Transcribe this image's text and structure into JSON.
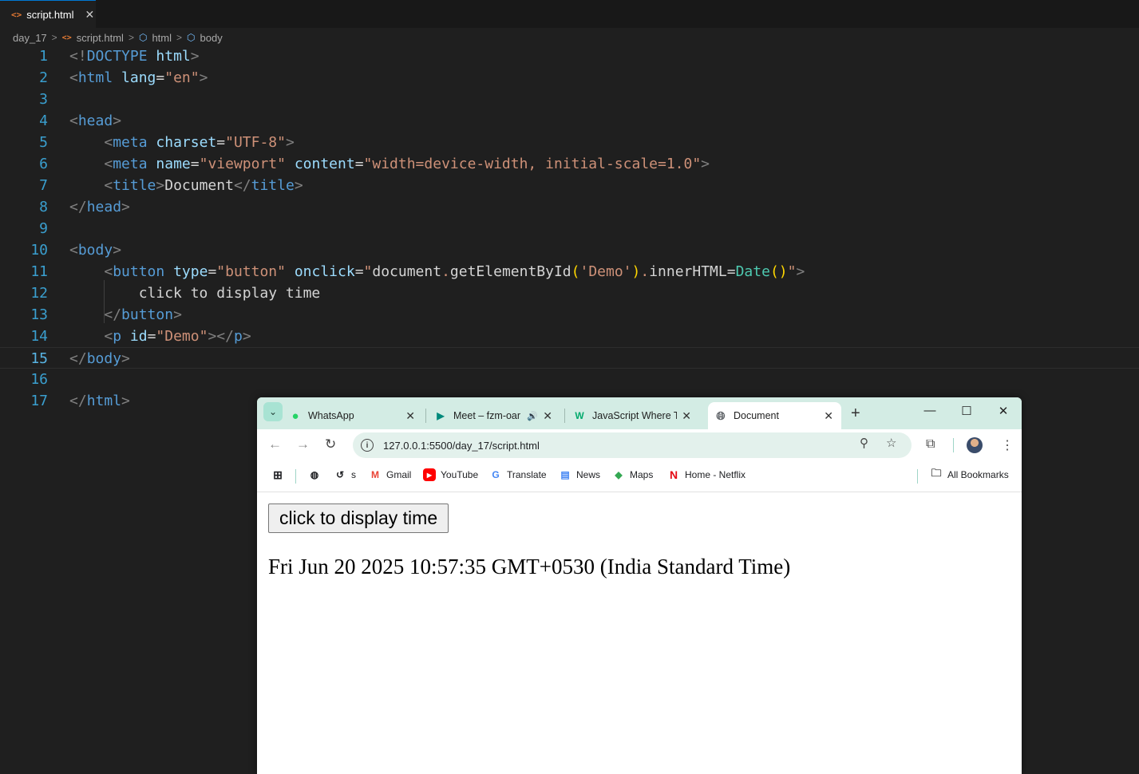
{
  "editor": {
    "tab": {
      "label": "script.html",
      "close": "✕"
    },
    "breadcrumb": [
      "day_17",
      "script.html",
      "html",
      "body"
    ],
    "lines": [
      {
        "n": "1",
        "segs": [
          [
            "p",
            "<!"
          ],
          [
            "t",
            "DOCTYPE"
          ],
          [
            "w",
            " "
          ],
          [
            "a",
            "html"
          ],
          [
            "p",
            ">"
          ]
        ]
      },
      {
        "n": "2",
        "segs": [
          [
            "p",
            "<"
          ],
          [
            "t",
            "html"
          ],
          [
            "w",
            " "
          ],
          [
            "a",
            "lang"
          ],
          [
            "w",
            "="
          ],
          [
            "s",
            "\"en\""
          ],
          [
            "p",
            ">"
          ]
        ]
      },
      {
        "n": "3",
        "segs": []
      },
      {
        "n": "4",
        "segs": [
          [
            "p",
            "<"
          ],
          [
            "t",
            "head"
          ],
          [
            "p",
            ">"
          ]
        ]
      },
      {
        "n": "5",
        "segs": [
          [
            "w",
            "    "
          ],
          [
            "p",
            "<"
          ],
          [
            "t",
            "meta"
          ],
          [
            "w",
            " "
          ],
          [
            "a",
            "charset"
          ],
          [
            "w",
            "="
          ],
          [
            "s",
            "\"UTF-8\""
          ],
          [
            "p",
            ">"
          ]
        ]
      },
      {
        "n": "6",
        "segs": [
          [
            "w",
            "    "
          ],
          [
            "p",
            "<"
          ],
          [
            "t",
            "meta"
          ],
          [
            "w",
            " "
          ],
          [
            "a",
            "name"
          ],
          [
            "w",
            "="
          ],
          [
            "s",
            "\"viewport\""
          ],
          [
            "w",
            " "
          ],
          [
            "a",
            "content"
          ],
          [
            "w",
            "="
          ],
          [
            "s",
            "\"width=device-width, initial-scale=1.0\""
          ],
          [
            "p",
            ">"
          ]
        ]
      },
      {
        "n": "7",
        "segs": [
          [
            "w",
            "    "
          ],
          [
            "p",
            "<"
          ],
          [
            "t",
            "title"
          ],
          [
            "p",
            ">"
          ],
          [
            "w",
            "Document"
          ],
          [
            "p",
            "</"
          ],
          [
            "t",
            "title"
          ],
          [
            "p",
            ">"
          ]
        ]
      },
      {
        "n": "8",
        "segs": [
          [
            "p",
            "</"
          ],
          [
            "t",
            "head"
          ],
          [
            "p",
            ">"
          ]
        ]
      },
      {
        "n": "9",
        "segs": []
      },
      {
        "n": "10",
        "segs": [
          [
            "p",
            "<"
          ],
          [
            "t",
            "body"
          ],
          [
            "p",
            ">"
          ]
        ]
      },
      {
        "n": "11",
        "segs": [
          [
            "w",
            "    "
          ],
          [
            "p",
            "<"
          ],
          [
            "t",
            "button"
          ],
          [
            "w",
            " "
          ],
          [
            "a",
            "type"
          ],
          [
            "w",
            "="
          ],
          [
            "s",
            "\"button\""
          ],
          [
            "w",
            " "
          ],
          [
            "a",
            "onclick"
          ],
          [
            "w",
            "="
          ],
          [
            "s",
            "\""
          ],
          [
            "w",
            "document"
          ],
          [
            "s",
            "."
          ],
          [
            "w",
            "getElementById"
          ],
          [
            "y",
            "("
          ],
          [
            "s",
            "'Demo'"
          ],
          [
            "y",
            ")"
          ],
          [
            "s",
            "."
          ],
          [
            "w",
            "innerHTML"
          ],
          [
            "w",
            "="
          ],
          [
            "f",
            "Date"
          ],
          [
            "y",
            "()"
          ],
          [
            "s",
            "\""
          ],
          [
            "p",
            ">"
          ]
        ]
      },
      {
        "n": "12",
        "segs": [
          [
            "w",
            "        click to display time"
          ]
        ]
      },
      {
        "n": "13",
        "segs": [
          [
            "w",
            "    "
          ],
          [
            "p",
            "</"
          ],
          [
            "t",
            "button"
          ],
          [
            "p",
            ">"
          ]
        ]
      },
      {
        "n": "14",
        "segs": [
          [
            "w",
            "    "
          ],
          [
            "p",
            "<"
          ],
          [
            "t",
            "p"
          ],
          [
            "w",
            " "
          ],
          [
            "a",
            "id"
          ],
          [
            "w",
            "="
          ],
          [
            "s",
            "\"Demo\""
          ],
          [
            "p",
            "></"
          ],
          [
            "t",
            "p"
          ],
          [
            "p",
            ">"
          ]
        ]
      },
      {
        "n": "15",
        "segs": [
          [
            "p",
            "</"
          ],
          [
            "t",
            "body"
          ],
          [
            "p",
            ">"
          ]
        ]
      },
      {
        "n": "16",
        "segs": []
      },
      {
        "n": "17",
        "segs": [
          [
            "p",
            "</"
          ],
          [
            "t",
            "html"
          ],
          [
            "p",
            ">"
          ]
        ]
      }
    ]
  },
  "browser": {
    "tabs": [
      {
        "title": "WhatsApp",
        "icon": "whatsapp-icon"
      },
      {
        "title": "Meet – fzm-oar",
        "icon": "meet-icon",
        "audio": "🔊"
      },
      {
        "title": "JavaScript Where To",
        "icon": "w3schools-icon"
      },
      {
        "title": "Document",
        "icon": "globe-icon"
      }
    ],
    "close": "✕",
    "new_tab": "+",
    "controls": {
      "minimize": "—",
      "maximize": "☐",
      "close": "✕"
    },
    "url": "127.0.0.1:5500/day_17/script.html",
    "bookmarks": [
      {
        "label": "s",
        "icon": "history-icon"
      },
      {
        "label": "Gmail",
        "icon": "gmail-icon"
      },
      {
        "label": "YouTube",
        "icon": "youtube-icon"
      },
      {
        "label": "Translate",
        "icon": "translate-icon"
      },
      {
        "label": "News",
        "icon": "news-icon"
      },
      {
        "label": "Maps",
        "icon": "maps-icon"
      },
      {
        "label": "Home - Netflix",
        "icon": "netflix-icon"
      }
    ],
    "all_bookmarks": "All Bookmarks",
    "page": {
      "button_label": "click to display time",
      "date_text": "Fri Jun 20 2025 10:57:35 GMT+0530 (India Standard Time)"
    }
  }
}
